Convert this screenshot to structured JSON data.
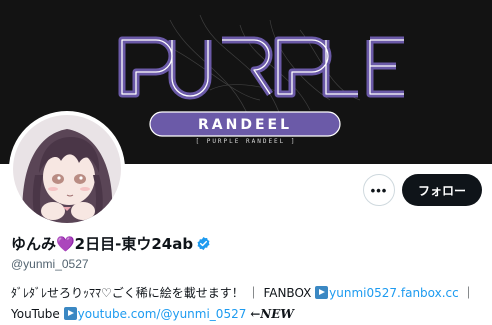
{
  "banner": {
    "title": "PURPLE RANDEEL",
    "logo_main": "PURPLE",
    "logo_sub": "RANDEEL",
    "subtitle": "[ PURPLE RANDEEL ]",
    "accent_color": "#6b5aa8"
  },
  "profile": {
    "display_name": "ゆんみ💜2日目-東ウ24ab",
    "handle": "@yunmi_0527",
    "verified": true,
    "verified_color": "#1d9bf0"
  },
  "actions": {
    "more_label": "•••",
    "follow_label": "フォロー"
  },
  "bio": {
    "intro": "ﾀﾞﾚﾀﾞﾚせろりｯﾏﾏ♡ごく稀に絵を載せます！",
    "sep1": "｜",
    "fanbox_label": "FANBOX",
    "fanbox_link": "yunmi0527.fanbox.cc",
    "sep2": "｜",
    "youtube_label": "YouTube",
    "youtube_link": "youtube.com/@yunmi_0527",
    "new_label": "←NEW"
  },
  "icons": [
    "more-icon",
    "verified-badge-icon",
    "play-button-icon",
    "play-button-icon"
  ]
}
